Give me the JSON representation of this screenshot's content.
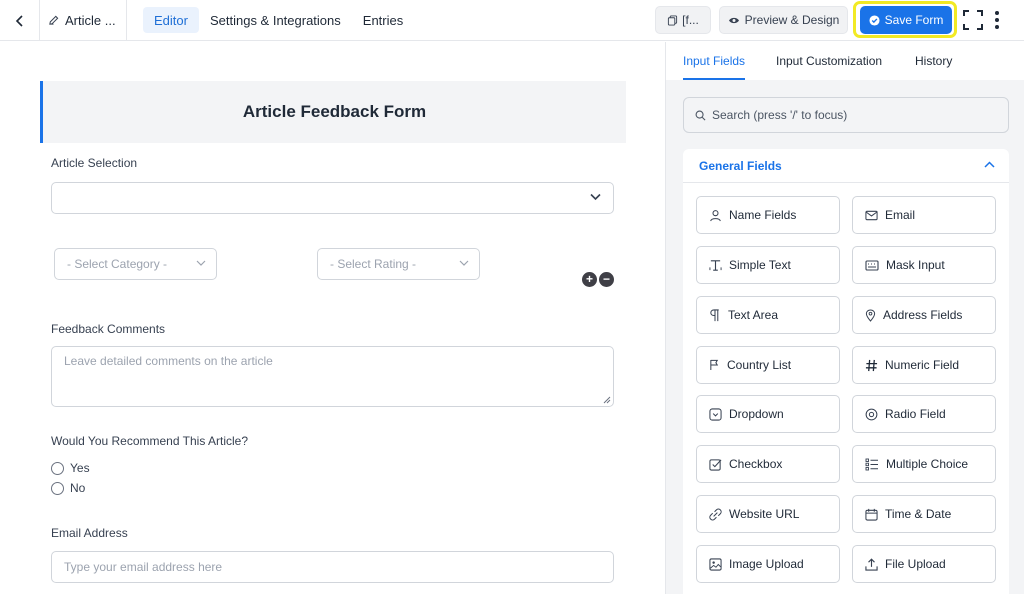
{
  "topbar": {
    "form_title": "Article ...",
    "tabs": [
      {
        "label": "Editor",
        "active": true
      },
      {
        "label": "Settings & Integrations",
        "active": false
      },
      {
        "label": "Entries",
        "active": false
      }
    ],
    "shortcode_label": "[f...",
    "preview_label": "Preview & Design",
    "save_label": "Save Form",
    "accent_color": "#1a73e8",
    "highlight_color": "#f2ea24"
  },
  "form": {
    "title": "Article Feedback Form",
    "article_selection": {
      "label": "Article Selection",
      "value": ""
    },
    "category_placeholder": "- Select Category -",
    "rating_placeholder": "- Select Rating -",
    "comments": {
      "label": "Feedback Comments",
      "placeholder": "Leave detailed comments on the article"
    },
    "recommend": {
      "label": "Would You Recommend This Article?",
      "options": [
        "Yes",
        "No"
      ]
    },
    "email": {
      "label": "Email Address",
      "placeholder": "Type your email address here"
    }
  },
  "sidebar": {
    "tabs": [
      {
        "label": "Input Fields",
        "active": true
      },
      {
        "label": "Input Customization",
        "active": false
      },
      {
        "label": "History",
        "active": false
      }
    ],
    "search_placeholder": "Search (press '/' to focus)",
    "section_title": "General Fields",
    "fields": [
      {
        "label": "Name Fields",
        "icon": "user-icon"
      },
      {
        "label": "Email",
        "icon": "envelope-icon"
      },
      {
        "label": "Simple Text",
        "icon": "text-cursor-icon"
      },
      {
        "label": "Mask Input",
        "icon": "keyboard-icon"
      },
      {
        "label": "Text Area",
        "icon": "paragraph-icon"
      },
      {
        "label": "Address Fields",
        "icon": "map-pin-icon"
      },
      {
        "label": "Country List",
        "icon": "flag-icon"
      },
      {
        "label": "Numeric Field",
        "icon": "hash-icon"
      },
      {
        "label": "Dropdown",
        "icon": "dropdown-icon"
      },
      {
        "label": "Radio Field",
        "icon": "radio-icon"
      },
      {
        "label": "Checkbox",
        "icon": "checkbox-icon"
      },
      {
        "label": "Multiple Choice",
        "icon": "list-icon"
      },
      {
        "label": "Website URL",
        "icon": "link-icon"
      },
      {
        "label": "Time & Date",
        "icon": "calendar-icon"
      },
      {
        "label": "Image Upload",
        "icon": "image-icon"
      },
      {
        "label": "File Upload",
        "icon": "upload-icon"
      }
    ]
  }
}
